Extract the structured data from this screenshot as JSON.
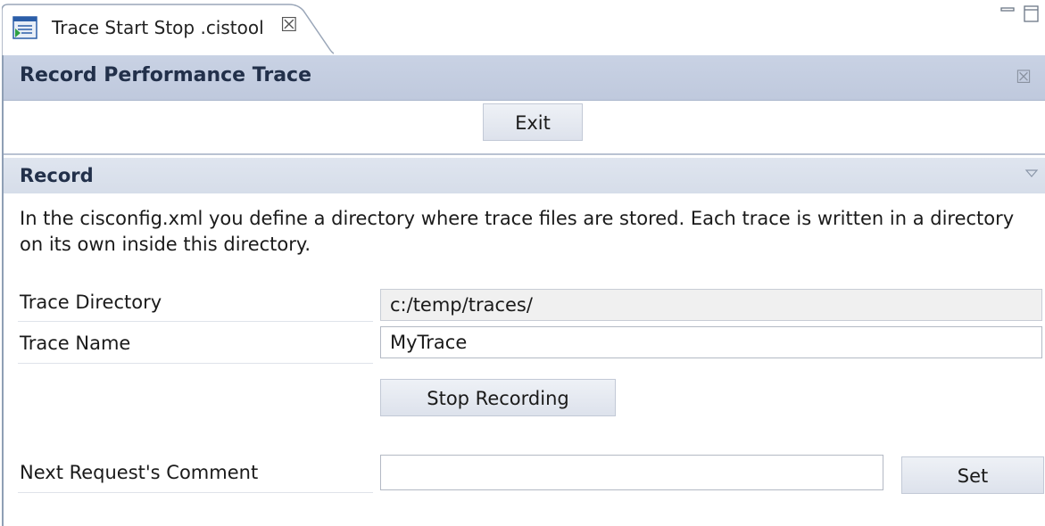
{
  "tab": {
    "title": "Trace Start Stop .cistool",
    "close_glyph": "☒",
    "icon": "editor-file-icon"
  },
  "form": {
    "title": "Record Performance Trace",
    "close_glyph": "☒",
    "exit_label": "Exit"
  },
  "record": {
    "title": "Record",
    "description": "In the cisconfig.xml you define a directory where trace files are stored. Each trace is written in a directory on its own inside this directory.",
    "trace_directory": {
      "label": "Trace Directory",
      "value": "c:/temp/traces/"
    },
    "trace_name": {
      "label": "Trace Name",
      "value": "MyTrace"
    },
    "stop_label": "Stop Recording",
    "comment": {
      "label": "Next Request's Comment",
      "value": ""
    },
    "set_label": "Set"
  },
  "colors": {
    "header_bg": "#c9d2e4",
    "section_bg": "#dfe5ef",
    "button_bg": "#e3e7ef",
    "title_text": "#22304a"
  }
}
